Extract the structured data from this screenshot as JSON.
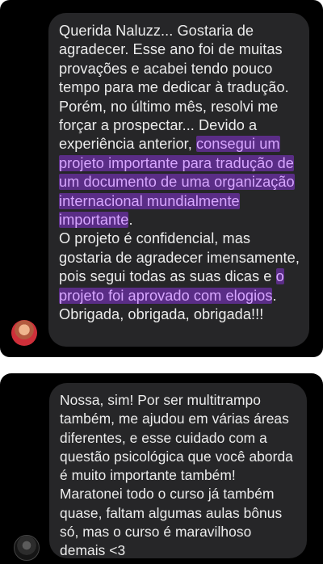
{
  "messages": [
    {
      "segments": [
        "Querida Naluzz... Gostaria de agradecer. Esse ano foi de muitas provações e acabei tendo pouco tempo para me dedicar à tradução. Porém, no último mês, resolvi me forçar a prospectar... Devido a experiência anterior, ",
        "consegui um projeto importante para tradução de um documento de uma organização internacional mundialmente importante",
        ".",
        "O projeto é confidencial, mas gostaria de agradecer imensamente, pois segui todas as suas dicas e ",
        "o projeto foi aprovado com elogios",
        ". Obrigada, obrigada, obrigada!!!"
      ],
      "highlight_color": "#5a2d86",
      "highlight_text_color": "#d7a6ff"
    },
    {
      "text": "Nossa, sim! Por ser multitrampo também, me ajudou em várias áreas diferentes, e esse cuidado com a questão psicológica que você aborda é muito importante também! Maratonei todo o curso já também quase, faltam algumas aulas bônus só, mas o curso é maravilhoso demais <3"
    }
  ],
  "colors": {
    "panel_background": "#000000",
    "bubble_background": "#262628",
    "text": "#ececec"
  }
}
